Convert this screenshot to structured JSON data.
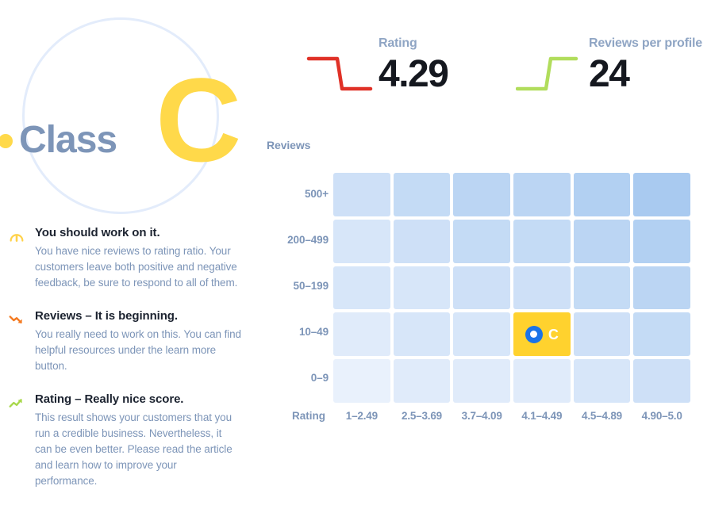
{
  "badge": {
    "dot_icon": "dot-icon",
    "class_word": "Class",
    "grade": "C",
    "ring_color": "#e3ecfb",
    "grade_color": "#ffd94a",
    "word_color": "#7d95b8"
  },
  "advice": {
    "items": [
      {
        "icon": "gauge-icon",
        "icon_color": "#ffd24a",
        "title": "You should work on it.",
        "body": "You have nice reviews to rating ratio. Your customers leave both positive and negative feedback, be sure to respond to all of them."
      },
      {
        "icon": "trend-down-icon",
        "icon_color": "#f47a21",
        "title": "Reviews – It is beginning.",
        "body": "You really need to work on this. You can find helpful resources under the learn more button."
      },
      {
        "icon": "trend-up-icon",
        "icon_color": "#a8d84b",
        "title": "Rating – Really nice score.",
        "body": "This result shows your customers that you run a credible business. Nevertheless, it can be even better. Please read the article and learn how to improve your performance."
      }
    ]
  },
  "kpis": [
    {
      "name": "rating",
      "label": "Rating",
      "value": "4.29",
      "spark_icon": "sparkline-step-down-icon",
      "spark_color": "#e03127",
      "trend": "down"
    },
    {
      "name": "reviews-per-profile",
      "label": "Reviews per profile",
      "value": "24",
      "spark_icon": "sparkline-step-up-icon",
      "spark_color": "#b1dd5c",
      "trend": "up"
    }
  ],
  "chart_data": {
    "type": "heatmap",
    "title": "",
    "ylabel": "Reviews",
    "xlabel": "Rating",
    "x_categories": [
      "1–2.49",
      "2.5–3.69",
      "3.7–4.09",
      "4.1–4.49",
      "4.5–4.89",
      "4.90–5.0"
    ],
    "y_categories": [
      "500+",
      "200–499",
      "50–199",
      "10–49",
      "0–9"
    ],
    "grid": true,
    "legend": "none",
    "colorscale": {
      "low": "#e9f1fc",
      "high": "#a9caf0",
      "description": "Blue intensity increases toward top-right (higher rating and more reviews)"
    },
    "values": [
      [
        4,
        5,
        6,
        6,
        7,
        8
      ],
      [
        3,
        4,
        5,
        5,
        6,
        7
      ],
      [
        3,
        3,
        4,
        4,
        5,
        6
      ],
      [
        2,
        3,
        3,
        3,
        4,
        5
      ],
      [
        1,
        2,
        2,
        2,
        3,
        4
      ]
    ],
    "highlight": {
      "row": 3,
      "col": 3,
      "row_label": "10–49",
      "col_label": "4.1–4.49",
      "grade": "C",
      "cell_color": "#ffd22e",
      "marker_color": "#1a73e8",
      "marker_icon": "position-marker-icon"
    }
  }
}
